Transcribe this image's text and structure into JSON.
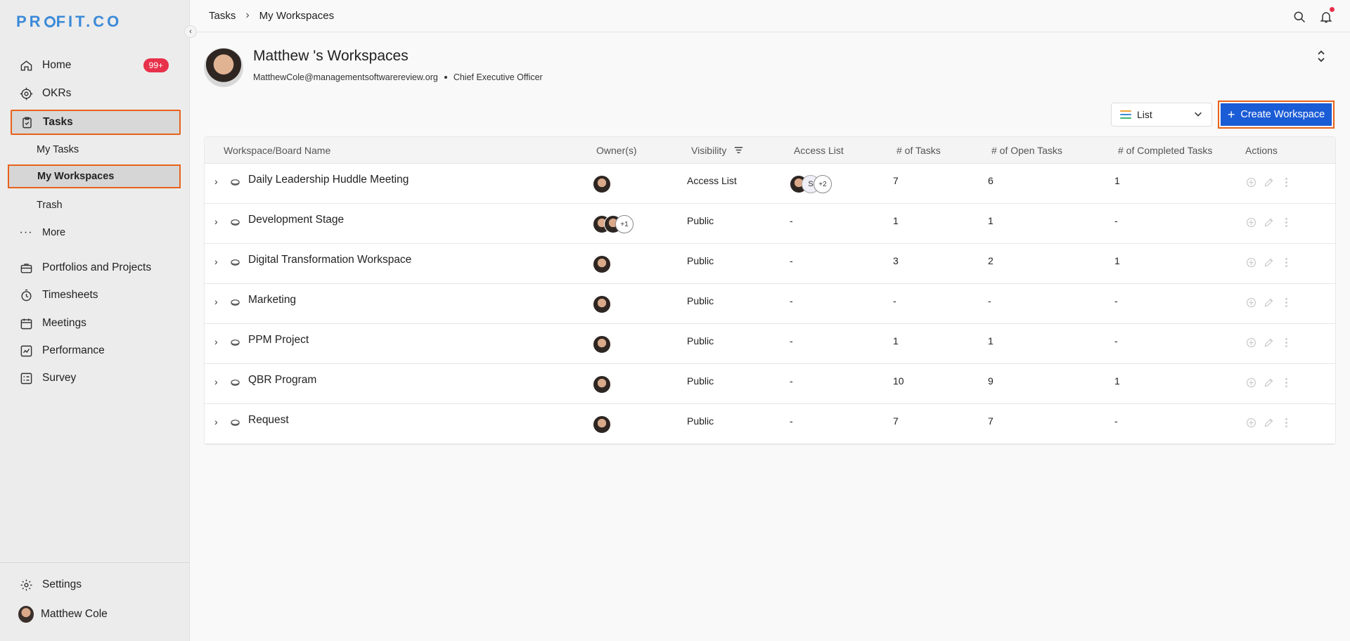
{
  "sidebar": {
    "logo": "PROFIT.CO",
    "nav": [
      {
        "label": "Home",
        "badge": "99+"
      },
      {
        "label": "OKRs"
      },
      {
        "label": "Tasks"
      }
    ],
    "sub": [
      "My Tasks",
      "My Workspaces",
      "Trash"
    ],
    "more": "More",
    "nav2": [
      "Portfolios and Projects",
      "Timesheets",
      "Meetings",
      "Performance",
      "Survey"
    ],
    "settings": "Settings",
    "user": "Matthew Cole"
  },
  "breadcrumb": {
    "root": "Tasks",
    "current": "My Workspaces"
  },
  "header": {
    "title": "Matthew 's Workspaces",
    "email": "MatthewCole@managementsoftwarereview.org",
    "role": "Chief Executive Officer"
  },
  "toolbar": {
    "view_label": "List",
    "create_label": "Create Workspace",
    "view_colors": [
      "#f2a33a",
      "#3c8ad8",
      "#3fb37a"
    ]
  },
  "table": {
    "columns": [
      "Workspace/Board Name",
      "Owner(s)",
      "Visibility",
      "Access List",
      "# of Tasks",
      "# of Open Tasks",
      "# of Completed Tasks",
      "Actions"
    ],
    "rows": [
      {
        "name": "Daily Leadership Huddle Meeting",
        "visibility": "Access List",
        "access": "+2",
        "access_s": "S",
        "tasks": "7",
        "open": "6",
        "completed": "1"
      },
      {
        "name": "Development Stage",
        "visibility": "Public",
        "access": "-",
        "owners_more": "+1",
        "tasks": "1",
        "open": "1",
        "completed": "-"
      },
      {
        "name": "Digital Transformation Workspace",
        "visibility": "Public",
        "access": "-",
        "tasks": "3",
        "open": "2",
        "completed": "1"
      },
      {
        "name": "Marketing",
        "visibility": "Public",
        "access": "-",
        "tasks": "-",
        "open": "-",
        "completed": "-"
      },
      {
        "name": "PPM Project",
        "visibility": "Public",
        "access": "-",
        "tasks": "1",
        "open": "1",
        "completed": "-"
      },
      {
        "name": "QBR Program",
        "visibility": "Public",
        "access": "-",
        "tasks": "10",
        "open": "9",
        "completed": "1"
      },
      {
        "name": "Request",
        "visibility": "Public",
        "access": "-",
        "tasks": "7",
        "open": "7",
        "completed": "-"
      }
    ]
  },
  "colors": {
    "accent": "#1a5bd6",
    "highlight": "#e8621a",
    "badge": "#e8314a"
  }
}
